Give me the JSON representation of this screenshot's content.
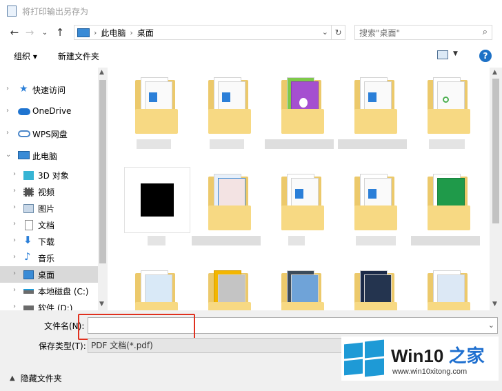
{
  "window": {
    "title": "将打印输出另存为"
  },
  "address": {
    "crumbs": [
      "此电脑",
      "桌面"
    ],
    "search_placeholder": "搜索\"桌面\""
  },
  "toolbar": {
    "organize_label": "组织 ▾",
    "new_folder_label": "新建文件夹",
    "help_label": "?"
  },
  "nav": {
    "items": [
      {
        "label": "快速访问",
        "icon": "star-icon",
        "color": "#2b7fd8"
      },
      {
        "label": "OneDrive",
        "icon": "cloud-icon",
        "color": "#1f74d0"
      },
      {
        "label": "WPS网盘",
        "icon": "cloud-outline-icon",
        "color": "#4a86c8"
      },
      {
        "label": "此电脑",
        "icon": "computer-icon",
        "color": "#3a8bd6"
      },
      {
        "label": "3D 对象",
        "icon": "cube-icon",
        "color": "#36b4d4"
      },
      {
        "label": "视频",
        "icon": "film-icon",
        "color": "#555555"
      },
      {
        "label": "图片",
        "icon": "picture-icon",
        "color": "#6a8aa8"
      },
      {
        "label": "文档",
        "icon": "document-icon",
        "color": "#8a8a8a"
      },
      {
        "label": "下载",
        "icon": "download-arrow-icon",
        "color": "#2b7fd8"
      },
      {
        "label": "音乐",
        "icon": "music-note-icon",
        "color": "#2b7fd8"
      },
      {
        "label": "桌面",
        "icon": "desktop-icon",
        "color": "#3a8bd6"
      },
      {
        "label": "本地磁盘 (C:)",
        "icon": "drive-icon",
        "color": "#6b6b6b"
      },
      {
        "label": "软件 (D:)",
        "icon": "drive-icon",
        "color": "#6b6b6b"
      }
    ]
  },
  "bottom": {
    "filename_label": "文件名(N):",
    "filename_value": "",
    "type_label": "保存类型(T):",
    "type_value": "PDF 文档(*.pdf)",
    "hide_folders_label": "隐藏文件夹"
  },
  "watermark": {
    "brand_prefix": "Win10 ",
    "brand_suffix": "之家",
    "url": "www.win10xitong.com"
  }
}
